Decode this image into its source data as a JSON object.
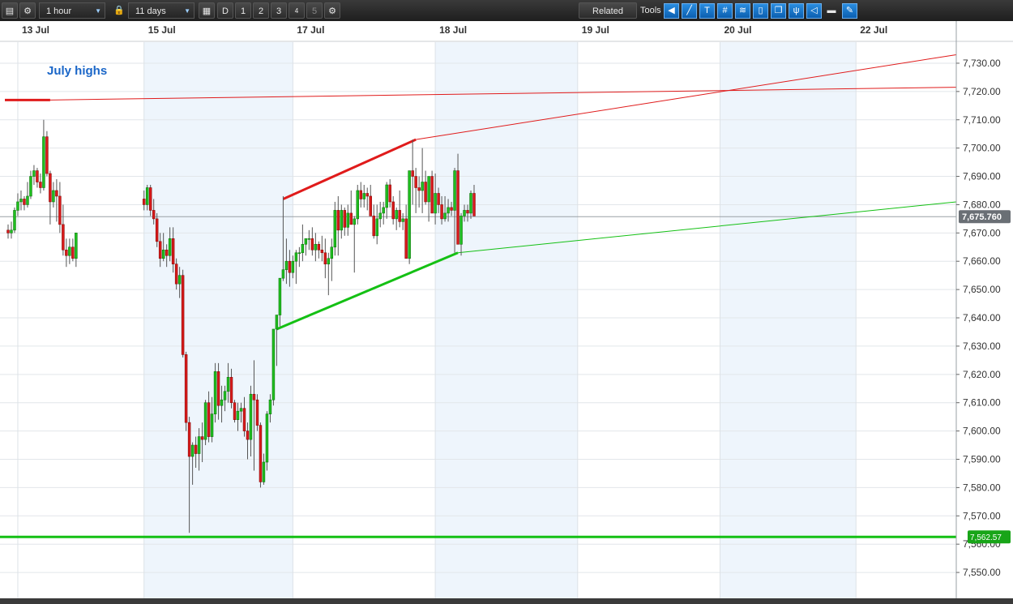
{
  "toolbar": {
    "interval_label": "1 hour",
    "range_label": "11 days",
    "period_buttons": [
      "D",
      "1",
      "2",
      "3",
      "4",
      "5"
    ],
    "related_label": "Related",
    "tools_label": "Tools"
  },
  "chart_data": {
    "type": "candlestick",
    "title": "",
    "xlabel": "",
    "ylabel": "",
    "ylim": [
      7542,
      7734
    ],
    "yticks": [
      "7,730.00",
      "7,720.00",
      "7,710.00",
      "7,700.00",
      "7,690.00",
      "7,680.00",
      "7,670.00",
      "7,660.00",
      "7,650.00",
      "7,640.00",
      "7,630.00",
      "7,620.00",
      "7,610.00",
      "7,600.00",
      "7,590.00",
      "7,580.00",
      "7,570.00",
      "7,560.00",
      "7,550.00"
    ],
    "ytick_values": [
      7730,
      7720,
      7710,
      7700,
      7690,
      7680,
      7670,
      7660,
      7650,
      7640,
      7630,
      7620,
      7610,
      7600,
      7590,
      7580,
      7570,
      7560,
      7550
    ],
    "date_labels": [
      "13 Jul",
      "15 Jul",
      "17 Jul",
      "18 Jul",
      "19 Jul",
      "20 Jul",
      "22 Jul"
    ],
    "date_label_hours": [
      0,
      39,
      85,
      129,
      173,
      217,
      259
    ],
    "shaded_day_ranges": [
      [
        39,
        85
      ],
      [
        129,
        173
      ],
      [
        217,
        259
      ]
    ],
    "day_separator_hours": [
      0,
      39,
      85,
      129,
      173,
      217,
      259
    ],
    "hour_range": [
      -4,
      290
    ],
    "candles": [
      [
        -3,
        7671,
        7673,
        7668,
        7670
      ],
      [
        -2,
        7670,
        7674,
        7668,
        7671
      ],
      [
        -1,
        7671,
        7679,
        7670,
        7678
      ],
      [
        0,
        7678,
        7684,
        7676,
        7681
      ],
      [
        1,
        7681,
        7685,
        7678,
        7682
      ],
      [
        2,
        7682,
        7683,
        7678,
        7680
      ],
      [
        3,
        7680,
        7688,
        7679,
        7683
      ],
      [
        4,
        7683,
        7692,
        7682,
        7690
      ],
      [
        5,
        7690,
        7694,
        7687,
        7692
      ],
      [
        6,
        7692,
        7693,
        7686,
        7688
      ],
      [
        7,
        7688,
        7691,
        7684,
        7686
      ],
      [
        8,
        7686,
        7710,
        7685,
        7704
      ],
      [
        9,
        7704,
        7706,
        7690,
        7691
      ],
      [
        10,
        7691,
        7692,
        7673,
        7681
      ],
      [
        11,
        7681,
        7688,
        7679,
        7685
      ],
      [
        12,
        7685,
        7689,
        7674,
        7683
      ],
      [
        13,
        7683,
        7688,
        7670,
        7673
      ],
      [
        14,
        7673,
        7680,
        7662,
        7664
      ],
      [
        15,
        7664,
        7668,
        7658,
        7662
      ],
      [
        16,
        7662,
        7668,
        7659,
        7665
      ],
      [
        17,
        7665,
        7668,
        7660,
        7661
      ],
      [
        18,
        7661,
        7669,
        7658,
        7670
      ],
      [
        39,
        7682,
        7685,
        7678,
        7680
      ],
      [
        40,
        7680,
        7687,
        7678,
        7686
      ],
      [
        41,
        7686,
        7687,
        7676,
        7678
      ],
      [
        42,
        7678,
        7682,
        7673,
        7675
      ],
      [
        43,
        7675,
        7677,
        7665,
        7667
      ],
      [
        44,
        7667,
        7670,
        7658,
        7661
      ],
      [
        45,
        7661,
        7670,
        7660,
        7664
      ],
      [
        46,
        7664,
        7666,
        7658,
        7662
      ],
      [
        47,
        7662,
        7672,
        7660,
        7668
      ],
      [
        48,
        7668,
        7672,
        7656,
        7659
      ],
      [
        49,
        7659,
        7661,
        7650,
        7652
      ],
      [
        50,
        7652,
        7658,
        7647,
        7655
      ],
      [
        51,
        7655,
        7657,
        7626,
        7627
      ],
      [
        52,
        7627,
        7628,
        7600,
        7603
      ],
      [
        53,
        7603,
        7605,
        7564,
        7591
      ],
      [
        54,
        7591,
        7596,
        7581,
        7595
      ],
      [
        55,
        7595,
        7598,
        7587,
        7592
      ],
      [
        56,
        7592,
        7601,
        7586,
        7598
      ],
      [
        57,
        7598,
        7603,
        7589,
        7597
      ],
      [
        58,
        7597,
        7611,
        7595,
        7610
      ],
      [
        59,
        7610,
        7614,
        7596,
        7598
      ],
      [
        60,
        7598,
        7612,
        7596,
        7606
      ],
      [
        61,
        7606,
        7624,
        7603,
        7621
      ],
      [
        62,
        7621,
        7624,
        7604,
        7609
      ],
      [
        63,
        7609,
        7616,
        7603,
        7611
      ],
      [
        64,
        7611,
        7616,
        7607,
        7614
      ],
      [
        65,
        7614,
        7624,
        7610,
        7619
      ],
      [
        66,
        7619,
        7622,
        7608,
        7610
      ],
      [
        67,
        7610,
        7611,
        7603,
        7604
      ],
      [
        68,
        7604,
        7610,
        7600,
        7607
      ],
      [
        69,
        7607,
        7610,
        7603,
        7608
      ],
      [
        70,
        7608,
        7612,
        7598,
        7600
      ],
      [
        71,
        7600,
        7603,
        7590,
        7597
      ],
      [
        72,
        7597,
        7616,
        7591,
        7613
      ],
      [
        73,
        7613,
        7625,
        7586,
        7611
      ],
      [
        74,
        7611,
        7613,
        7600,
        7602
      ],
      [
        75,
        7602,
        7603,
        7580,
        7582
      ],
      [
        76,
        7582,
        7592,
        7581,
        7589
      ],
      [
        77,
        7589,
        7607,
        7586,
        7606
      ],
      [
        78,
        7606,
        7613,
        7603,
        7611
      ],
      [
        79,
        7611,
        7636,
        7609,
        7636
      ],
      [
        80,
        7636,
        7641,
        7623,
        7641
      ],
      [
        81,
        7641,
        7654,
        7637,
        7654
      ],
      [
        82,
        7654,
        7683,
        7653,
        7657
      ],
      [
        83,
        7657,
        7668,
        7652,
        7660
      ],
      [
        84,
        7660,
        7664,
        7651,
        7656
      ],
      [
        85,
        7656,
        7662,
        7654,
        7660
      ],
      [
        86,
        7660,
        7664,
        7652,
        7663
      ],
      [
        87,
        7663,
        7665,
        7658,
        7663
      ],
      [
        88,
        7663,
        7673,
        7660,
        7666
      ],
      [
        89,
        7666,
        7668,
        7662,
        7668
      ],
      [
        90,
        7668,
        7671,
        7664,
        7668
      ],
      [
        91,
        7668,
        7672,
        7662,
        7664
      ],
      [
        92,
        7664,
        7670,
        7660,
        7666
      ],
      [
        93,
        7666,
        7667,
        7661,
        7664
      ],
      [
        94,
        7664,
        7669,
        7660,
        7663
      ],
      [
        95,
        7663,
        7668,
        7654,
        7659
      ],
      [
        96,
        7659,
        7663,
        7648,
        7661
      ],
      [
        97,
        7661,
        7668,
        7653,
        7665
      ],
      [
        98,
        7665,
        7681,
        7662,
        7678
      ],
      [
        99,
        7678,
        7683,
        7662,
        7671
      ],
      [
        100,
        7671,
        7680,
        7668,
        7678
      ],
      [
        101,
        7678,
        7679,
        7669,
        7672
      ],
      [
        102,
        7672,
        7680,
        7669,
        7677
      ],
      [
        103,
        7677,
        7685,
        7673,
        7673
      ],
      [
        104,
        7673,
        7676,
        7656,
        7675
      ],
      [
        105,
        7675,
        7687,
        7673,
        7685
      ],
      [
        106,
        7685,
        7688,
        7679,
        7682
      ],
      [
        107,
        7682,
        7687,
        7679,
        7684
      ],
      [
        108,
        7684,
        7686,
        7678,
        7683
      ],
      [
        109,
        7683,
        7687,
        7678,
        7676
      ],
      [
        110,
        7676,
        7680,
        7668,
        7669
      ],
      [
        111,
        7669,
        7680,
        7666,
        7675
      ],
      [
        112,
        7675,
        7681,
        7672,
        7677
      ],
      [
        113,
        7677,
        7681,
        7673,
        7679
      ],
      [
        114,
        7679,
        7688,
        7675,
        7687
      ],
      [
        115,
        7687,
        7689,
        7679,
        7681
      ],
      [
        116,
        7681,
        7683,
        7673,
        7675
      ],
      [
        117,
        7675,
        7679,
        7671,
        7678
      ],
      [
        118,
        7678,
        7685,
        7672,
        7674
      ],
      [
        119,
        7674,
        7677,
        7671,
        7675
      ],
      [
        120,
        7675,
        7680,
        7662,
        7661
      ],
      [
        121,
        7661,
        7691,
        7659,
        7692
      ],
      [
        122,
        7692,
        7703,
        7680,
        7690
      ],
      [
        123,
        7690,
        7693,
        7677,
        7686
      ],
      [
        124,
        7686,
        7690,
        7679,
        7685
      ],
      [
        125,
        7685,
        7700,
        7677,
        7688
      ],
      [
        126,
        7688,
        7692,
        7680,
        7681
      ],
      [
        127,
        7681,
        7690,
        7674,
        7690
      ],
      [
        128,
        7690,
        7692,
        7677,
        7677
      ],
      [
        129,
        7677,
        7691,
        7673,
        7684
      ],
      [
        130,
        7684,
        7686,
        7677,
        7680
      ],
      [
        131,
        7680,
        7683,
        7673,
        7675
      ],
      [
        132,
        7675,
        7683,
        7674,
        7677
      ],
      [
        133,
        7677,
        7682,
        7674,
        7679
      ],
      [
        134,
        7679,
        7681,
        7676,
        7678
      ],
      [
        135,
        7678,
        7693,
        7663,
        7692
      ],
      [
        136,
        7692,
        7698,
        7684,
        7666
      ],
      [
        137,
        7666,
        7677,
        7662,
        7676
      ],
      [
        138,
        7676,
        7680,
        7674,
        7678
      ],
      [
        139,
        7678,
        7680,
        7674,
        7677
      ],
      [
        140,
        7677,
        7685,
        7675,
        7684
      ],
      [
        141,
        7684,
        7687,
        7676,
        7676
      ]
    ],
    "trendlines": [
      {
        "p1": [
          -4,
          7717
        ],
        "p2": [
          10,
          7717
        ],
        "color": "#e01b1b",
        "width": 3
      },
      {
        "p1": [
          10,
          7717
        ],
        "p2": [
          290,
          7721.5
        ],
        "color": "#e01b1b",
        "width": 1
      },
      {
        "p1": [
          82,
          7682
        ],
        "p2": [
          123,
          7703
        ],
        "color": "#e01b1b",
        "width": 3
      },
      {
        "p1": [
          123,
          7703
        ],
        "p2": [
          290,
          7733
        ],
        "color": "#e01b1b",
        "width": 1
      },
      {
        "p1": [
          80,
          7636
        ],
        "p2": [
          136,
          7663
        ],
        "color": "#14c014",
        "width": 3
      },
      {
        "p1": [
          136,
          7663
        ],
        "p2": [
          290,
          7681
        ],
        "color": "#14c014",
        "width": 1
      }
    ],
    "horizontal_levels": [
      {
        "value": 7562.57,
        "label": "7,562.57",
        "color": "#14c014"
      }
    ],
    "current_price": {
      "value": 7675.76,
      "label": "7,675.760"
    },
    "annotations": [
      {
        "text": "July highs",
        "color": "#1a66c8"
      }
    ]
  }
}
